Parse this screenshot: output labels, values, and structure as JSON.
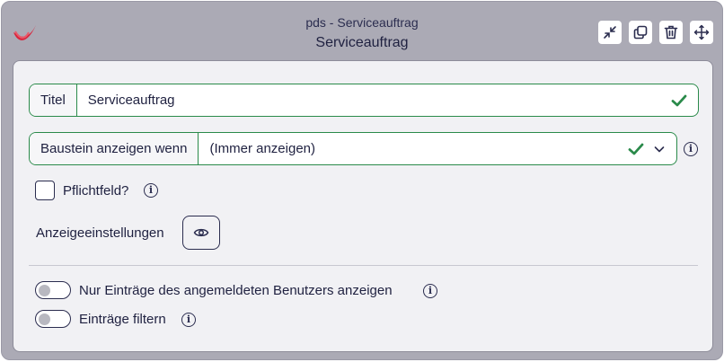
{
  "window": {
    "subtitle": "pds - Serviceauftrag",
    "title": "Serviceauftrag"
  },
  "toolbar": {
    "buttons": [
      "minimize-icon",
      "duplicate-icon",
      "trash-icon",
      "move-icon"
    ]
  },
  "form": {
    "title_field": {
      "label": "Titel",
      "value": "Serviceauftrag"
    },
    "show_when_field": {
      "label": "Baustein anzeigen wenn",
      "value": "(Immer anzeigen)"
    },
    "required": {
      "label": "Pflichtfeld?",
      "checked": false
    },
    "display_settings": {
      "label": "Anzeigeeinstellungen"
    },
    "toggles": [
      {
        "label": "Nur Einträge des angemeldeten Benutzers anzeigen",
        "on": false
      },
      {
        "label": "Einträge filtern",
        "on": false
      }
    ]
  },
  "colors": {
    "window_bg": "#abaab5",
    "valid_green": "#2a8a4a",
    "logo_red": "#d9233b"
  }
}
